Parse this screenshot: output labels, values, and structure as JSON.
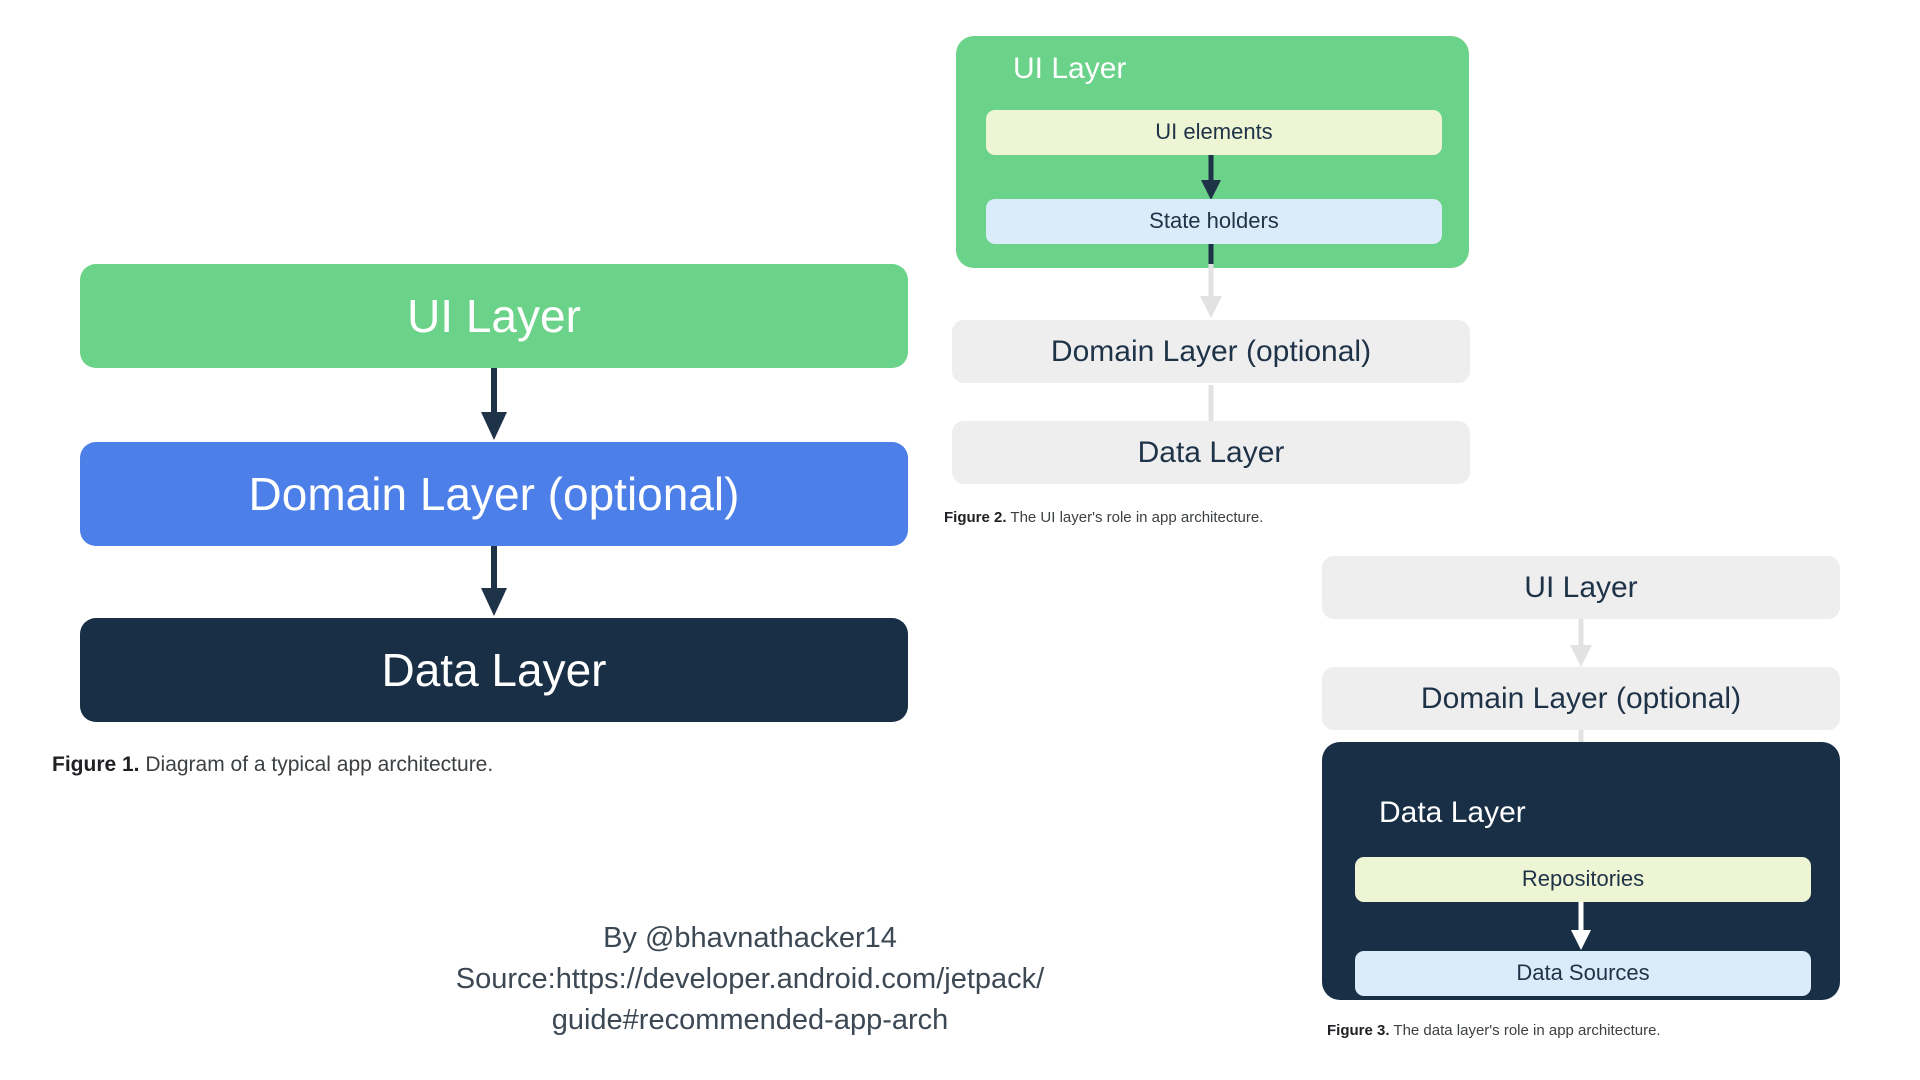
{
  "figures": [
    {
      "id": "figure-1",
      "caption_label": "Figure 1.",
      "caption_text": " Diagram of a typical app architecture.",
      "nodes": [
        {
          "label": "UI Layer",
          "style": "green"
        },
        {
          "label": "Domain Layer (optional)",
          "style": "blue"
        },
        {
          "label": "Data Layer",
          "style": "navy"
        }
      ],
      "arrows": [
        "dark",
        "dark"
      ]
    },
    {
      "id": "figure-2",
      "caption_label": "Figure 2.",
      "caption_text": " The UI layer's role in app architecture.",
      "panel_title": "UI Layer",
      "panel_style": "green",
      "inner_nodes": [
        {
          "label": "UI elements",
          "style": "cream"
        },
        {
          "label": "State holders",
          "style": "lightblue"
        }
      ],
      "nodes": [
        {
          "label": "Domain Layer (optional)",
          "style": "grey"
        },
        {
          "label": "Data Layer",
          "style": "grey"
        }
      ],
      "arrows": [
        "dark",
        "light",
        "light"
      ]
    },
    {
      "id": "figure-3",
      "caption_label": "Figure 3.",
      "caption_text": " The data layer's role in app architecture.",
      "panel_title": "Data Layer",
      "panel_style": "navy",
      "nodes": [
        {
          "label": "UI Layer",
          "style": "grey"
        },
        {
          "label": "Domain Layer (optional)",
          "style": "grey"
        }
      ],
      "inner_nodes": [
        {
          "label": "Repositories",
          "style": "cream"
        },
        {
          "label": "Data Sources",
          "style": "lightblue"
        }
      ],
      "arrows": [
        "light",
        "light",
        "white"
      ]
    }
  ],
  "attribution": {
    "line1": "By @bhavnathacker14",
    "line2": "Source:https://developer.android.com/jetpack/",
    "line3": "guide#recommended-app-arch"
  },
  "colors": {
    "green": "#6BD28A",
    "blue": "#4C7FE8",
    "navy": "#182F45",
    "grey": "#EEEEEE",
    "cream": "#EEF5D4",
    "lightblue": "#DAEBFA",
    "arrow_dark": "#1F3348",
    "arrow_light": "#E2E2E2",
    "arrow_white": "#FFFFFF",
    "background": "#FFFFFF",
    "caption_text": "#3c4043"
  }
}
